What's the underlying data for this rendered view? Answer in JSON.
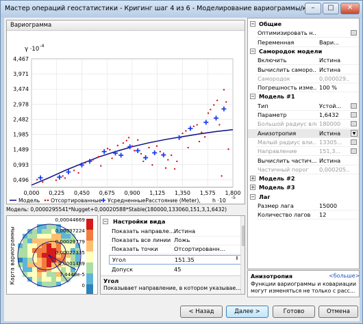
{
  "window": {
    "title": "Мастер операций геостатистики - Кригинг шаг 4 из 6 - Моделирование вариограммы/ковариа...",
    "minimize": "–",
    "maximize": "□",
    "close": "✕"
  },
  "chart_pane": {
    "header": "Вариограмма",
    "y_unit": "γ ·10",
    "y_unit_exp": "-4",
    "x_unit": "h ·10",
    "x_unit_exp": "-5",
    "legend": {
      "model": "Модель",
      "sorted": "Отсортированные",
      "averaged": "УсредненныеРасстояние (Meter),"
    },
    "formula": "Модель: 0,0000295541*Nugget+0,00020588*Stable(180000,133060,151,3,1,6432)"
  },
  "chart_data": {
    "type": "scatter",
    "xlim": [
      0,
      1.8
    ],
    "ylim": [
      0.248,
      4.467
    ],
    "xticks": [
      "0,000",
      "0,225",
      "0,450",
      "0,675",
      "0,900",
      "1,125",
      "1,350",
      "1,575",
      "1,800"
    ],
    "yticks": [
      "0,496",
      "0,993",
      "1,489",
      "1,985",
      "2,482",
      "2,978",
      "3,474",
      "3,971",
      "4,467"
    ],
    "xtick_values": [
      0,
      0.225,
      0.45,
      0.675,
      0.9,
      1.125,
      1.35,
      1.575,
      1.8
    ],
    "ytick_values": [
      0.496,
      0.993,
      1.489,
      1.985,
      2.482,
      2.978,
      3.474,
      3.971,
      4.467
    ],
    "averaged": [
      [
        0.08,
        0.56
      ],
      [
        0.25,
        0.58
      ],
      [
        0.33,
        0.75
      ],
      [
        0.45,
        0.98
      ],
      [
        0.52,
        1.1
      ],
      [
        0.65,
        1.42
      ],
      [
        0.75,
        1.37
      ],
      [
        0.8,
        1.3
      ],
      [
        0.88,
        1.58
      ],
      [
        0.95,
        1.45
      ],
      [
        1.02,
        1.22
      ],
      [
        1.1,
        1.38
      ],
      [
        1.18,
        1.31
      ],
      [
        1.32,
        1.88
      ],
      [
        1.42,
        2.18
      ],
      [
        1.56,
        2.38
      ],
      [
        1.65,
        2.52
      ],
      [
        1.72,
        2.82
      ]
    ],
    "sorted": [
      [
        0.05,
        0.5
      ],
      [
        0.1,
        0.42
      ],
      [
        0.22,
        0.48
      ],
      [
        0.28,
        0.62
      ],
      [
        0.3,
        0.55
      ],
      [
        0.38,
        0.8
      ],
      [
        0.42,
        0.72
      ],
      [
        0.48,
        1.05
      ],
      [
        0.55,
        1.15
      ],
      [
        0.6,
        1.25
      ],
      [
        0.62,
        0.95
      ],
      [
        0.68,
        1.52
      ],
      [
        0.7,
        1.48
      ],
      [
        0.72,
        1.2
      ],
      [
        0.77,
        1.62
      ],
      [
        0.82,
        1.7
      ],
      [
        0.85,
        1.78
      ],
      [
        0.87,
        1.88
      ],
      [
        0.9,
        1.6
      ],
      [
        0.92,
        1.45
      ],
      [
        0.95,
        1.8
      ],
      [
        0.98,
        1.35
      ],
      [
        1.0,
        1.1
      ],
      [
        1.05,
        1.55
      ],
      [
        1.08,
        0.98
      ],
      [
        1.12,
        1.6
      ],
      [
        1.15,
        1.42
      ],
      [
        1.2,
        0.88
      ],
      [
        1.22,
        1.15
      ],
      [
        1.25,
        1.3
      ],
      [
        1.28,
        0.85
      ],
      [
        1.3,
        1.1
      ],
      [
        1.35,
        2.02
      ],
      [
        1.38,
        2.1
      ],
      [
        1.4,
        1.55
      ],
      [
        1.45,
        2.25
      ],
      [
        1.48,
        2.3
      ],
      [
        1.5,
        1.75
      ],
      [
        1.52,
        2.05
      ],
      [
        1.55,
        1.9
      ],
      [
        1.58,
        2.68
      ],
      [
        1.6,
        2.8
      ],
      [
        1.63,
        2.95
      ],
      [
        1.66,
        3.1
      ],
      [
        1.68,
        2.3
      ],
      [
        1.7,
        0.62
      ],
      [
        1.72,
        3.45
      ],
      [
        1.74,
        3.05
      ],
      [
        1.76,
        1.5
      ]
    ],
    "model_curve": [
      [
        0,
        0.32
      ],
      [
        0.15,
        0.55
      ],
      [
        0.3,
        0.8
      ],
      [
        0.45,
        1.03
      ],
      [
        0.6,
        1.24
      ],
      [
        0.75,
        1.42
      ],
      [
        0.9,
        1.58
      ],
      [
        1.05,
        1.71
      ],
      [
        1.2,
        1.82
      ],
      [
        1.35,
        1.91
      ],
      [
        1.5,
        2.0
      ],
      [
        1.65,
        2.08
      ],
      [
        1.8,
        2.14
      ]
    ]
  },
  "view_settings": {
    "category": "Настройки вида",
    "rows": [
      {
        "label": "Показать направле...",
        "value": "Истина"
      },
      {
        "label": "Показать все линии",
        "value": "Ложь"
      },
      {
        "label": "Показать точки",
        "value": "Отсортированн..."
      }
    ],
    "angle_label": "Угол",
    "angle_value": "151.35",
    "tolerance_label": "Допуск",
    "tolerance_value": "45",
    "desc_title": "Угол",
    "desc_text": "Показывает направление, в котором указывае..."
  },
  "map_pane": {
    "label": "Карта вариограммы",
    "scale": [
      "0,00044669",
      "0,00037224",
      "0,00029779",
      "0,00022335",
      "0,0001489",
      "7,4448e-5",
      "0"
    ],
    "colors": [
      "#d7191c",
      "#f07c3f",
      "#fdbf6f",
      "#ffffbf",
      "#abdda4",
      "#5fb5d8",
      "#2b83ba"
    ]
  },
  "properties": [
    {
      "type": "category",
      "label": "Общие",
      "pm": "−"
    },
    {
      "type": "row",
      "label": "Оптимизировать н...",
      "value": "",
      "icon": "optimize-icon"
    },
    {
      "type": "row",
      "label": "Переменная",
      "value": "Вари..."
    },
    {
      "type": "category",
      "label": "Самородок модели",
      "pm": "−"
    },
    {
      "type": "row",
      "label": "Включить",
      "value": "Истина"
    },
    {
      "type": "row",
      "label": "Вычислить саморо...",
      "value": "Истина"
    },
    {
      "type": "row",
      "label": "Самородок",
      "value": "0,000029...",
      "gray": true
    },
    {
      "type": "row",
      "label": "Погрешность изме...",
      "value": "100  %"
    },
    {
      "type": "category",
      "label": "Модель #1",
      "pm": "−"
    },
    {
      "type": "row",
      "label": "Тип",
      "value": "Устой...",
      "icon": "type-icon"
    },
    {
      "type": "row",
      "label": "Параметр",
      "value": "1,6432",
      "icon": "param-icon"
    },
    {
      "type": "row",
      "label": "Большой радиус вли...",
      "value": "180000",
      "icon": "range-icon",
      "gray": true
    },
    {
      "type": "row",
      "label": "Анизотропия",
      "value": "Истина",
      "dropdown": true,
      "selected": true
    },
    {
      "type": "row",
      "label": "Малый радиус вли...",
      "value": "13305...",
      "icon": "minor-icon",
      "gray": true
    },
    {
      "type": "row",
      "label": "Направление",
      "value": "151,3...",
      "icon": "dir-icon",
      "gray": true
    },
    {
      "type": "row",
      "label": "Вычислить частич...",
      "value": "Истина"
    },
    {
      "type": "row",
      "label": "Частичный порог",
      "value": "0,000205...",
      "gray": true
    },
    {
      "type": "category",
      "label": "Модель #2",
      "pm": "+"
    },
    {
      "type": "category",
      "label": "Модель #3",
      "pm": "+"
    },
    {
      "type": "category",
      "label": "Лаг",
      "pm": "−"
    },
    {
      "type": "row",
      "label": "Размер лага",
      "value": "15000"
    },
    {
      "type": "row",
      "label": "Количество лагов",
      "value": "12"
    }
  ],
  "description": {
    "title": "Анизотропия",
    "more": "<больше>",
    "text1": "Функции вариограммы и ковариации",
    "text2": "могут изменяться не только с расс..."
  },
  "buttons": {
    "back": "< Назад",
    "next": "Далее >",
    "finish": "Готово",
    "cancel": "Отмена"
  }
}
